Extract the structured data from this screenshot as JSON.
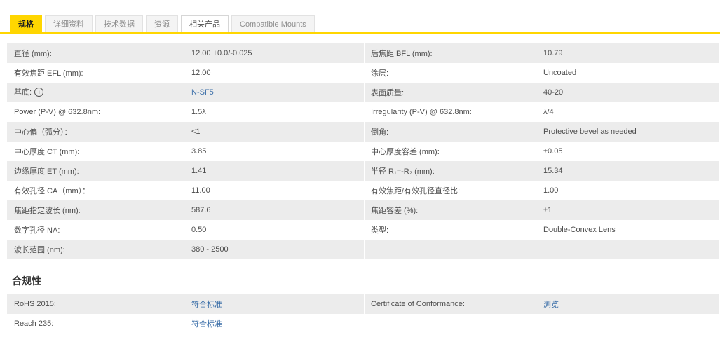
{
  "colors": {
    "accent": "#ffd600",
    "shade": "#ececec",
    "link": "#3a6ea8"
  },
  "tabs": [
    {
      "name": "tab-specifications",
      "label": "规格",
      "state": "active"
    },
    {
      "name": "tab-details",
      "label": "详细资料",
      "state": "inactive"
    },
    {
      "name": "tab-technical-data",
      "label": "技术数据",
      "state": "inactive"
    },
    {
      "name": "tab-resources",
      "label": "资源",
      "state": "inactive"
    },
    {
      "name": "tab-related-products",
      "label": "相关产品",
      "state": "white"
    },
    {
      "name": "tab-compatible-mounts",
      "label": "Compatible Mounts",
      "state": "inactive"
    }
  ],
  "specs": {
    "left": [
      {
        "label": "直径 (mm):",
        "value": "12.00 +0.0/-0.025",
        "link": false
      },
      {
        "label": "有效焦距 EFL (mm):",
        "value": "12.00",
        "link": false
      },
      {
        "label": "基底:",
        "value": "N-SF5",
        "link": true,
        "info_icon": true
      },
      {
        "label": "Power (P-V) @ 632.8nm:",
        "value": "1.5λ",
        "link": false
      },
      {
        "label": "中心偏（弧分）：",
        "value": "<1",
        "link": false
      },
      {
        "label": "中心厚度 CT (mm):",
        "value": "3.85",
        "link": false
      },
      {
        "label": "边缘厚度 ET (mm):",
        "value": "1.41",
        "link": false
      },
      {
        "label": "有效孔径 CA（mm）：",
        "value": "11.00",
        "link": false
      },
      {
        "label": "焦距指定波长 (nm):",
        "value": "587.6",
        "link": false
      },
      {
        "label": "数字孔径 NA:",
        "value": "0.50",
        "link": false
      },
      {
        "label": "波长范围 (nm):",
        "value": "380 - 2500",
        "link": false
      }
    ],
    "right": [
      {
        "label": "后焦距 BFL (mm):",
        "value": "10.79",
        "link": false
      },
      {
        "label": "涂层:",
        "value": "Uncoated",
        "link": false
      },
      {
        "label": "表面质量:",
        "value": "40-20",
        "link": false
      },
      {
        "label": "Irregularity (P-V) @ 632.8nm:",
        "value": "λ/4",
        "link": false
      },
      {
        "label": "倒角:",
        "value": "Protective bevel as needed",
        "link": false
      },
      {
        "label": "中心厚度容差 (mm):",
        "value": "±0.05",
        "link": false
      },
      {
        "label": "半径 R₁=-R₂ (mm):",
        "value": "15.34",
        "link": false
      },
      {
        "label": "有效焦距/有效孔径直径比:",
        "value": "1.00",
        "link": false
      },
      {
        "label": "焦距容差 (%):",
        "value": "±1",
        "link": false
      },
      {
        "label": "类型:",
        "value": "Double-Convex Lens",
        "link": false
      },
      {
        "label": "",
        "value": "",
        "link": false
      }
    ]
  },
  "compliance": {
    "title": "合规性",
    "left": [
      {
        "label": "RoHS 2015:",
        "value": "符合标准",
        "link": true
      },
      {
        "label": "Reach 235:",
        "value": "符合标准",
        "link": true
      }
    ],
    "right": [
      {
        "label": "Certificate of Conformance:",
        "value": "浏览",
        "link": true
      },
      {
        "label": "",
        "value": "",
        "link": false
      }
    ]
  }
}
